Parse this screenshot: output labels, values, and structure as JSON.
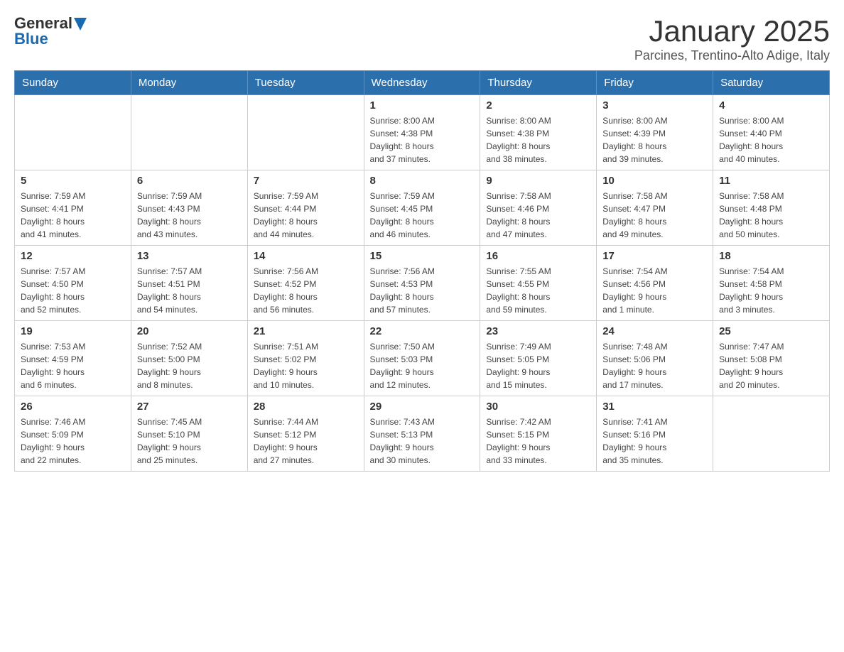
{
  "header": {
    "logo_general": "General",
    "logo_blue": "Blue",
    "month_title": "January 2025",
    "subtitle": "Parcines, Trentino-Alto Adige, Italy"
  },
  "days_of_week": [
    "Sunday",
    "Monday",
    "Tuesday",
    "Wednesday",
    "Thursday",
    "Friday",
    "Saturday"
  ],
  "weeks": [
    [
      {
        "day": "",
        "info": ""
      },
      {
        "day": "",
        "info": ""
      },
      {
        "day": "",
        "info": ""
      },
      {
        "day": "1",
        "info": "Sunrise: 8:00 AM\nSunset: 4:38 PM\nDaylight: 8 hours\nand 37 minutes."
      },
      {
        "day": "2",
        "info": "Sunrise: 8:00 AM\nSunset: 4:38 PM\nDaylight: 8 hours\nand 38 minutes."
      },
      {
        "day": "3",
        "info": "Sunrise: 8:00 AM\nSunset: 4:39 PM\nDaylight: 8 hours\nand 39 minutes."
      },
      {
        "day": "4",
        "info": "Sunrise: 8:00 AM\nSunset: 4:40 PM\nDaylight: 8 hours\nand 40 minutes."
      }
    ],
    [
      {
        "day": "5",
        "info": "Sunrise: 7:59 AM\nSunset: 4:41 PM\nDaylight: 8 hours\nand 41 minutes."
      },
      {
        "day": "6",
        "info": "Sunrise: 7:59 AM\nSunset: 4:43 PM\nDaylight: 8 hours\nand 43 minutes."
      },
      {
        "day": "7",
        "info": "Sunrise: 7:59 AM\nSunset: 4:44 PM\nDaylight: 8 hours\nand 44 minutes."
      },
      {
        "day": "8",
        "info": "Sunrise: 7:59 AM\nSunset: 4:45 PM\nDaylight: 8 hours\nand 46 minutes."
      },
      {
        "day": "9",
        "info": "Sunrise: 7:58 AM\nSunset: 4:46 PM\nDaylight: 8 hours\nand 47 minutes."
      },
      {
        "day": "10",
        "info": "Sunrise: 7:58 AM\nSunset: 4:47 PM\nDaylight: 8 hours\nand 49 minutes."
      },
      {
        "day": "11",
        "info": "Sunrise: 7:58 AM\nSunset: 4:48 PM\nDaylight: 8 hours\nand 50 minutes."
      }
    ],
    [
      {
        "day": "12",
        "info": "Sunrise: 7:57 AM\nSunset: 4:50 PM\nDaylight: 8 hours\nand 52 minutes."
      },
      {
        "day": "13",
        "info": "Sunrise: 7:57 AM\nSunset: 4:51 PM\nDaylight: 8 hours\nand 54 minutes."
      },
      {
        "day": "14",
        "info": "Sunrise: 7:56 AM\nSunset: 4:52 PM\nDaylight: 8 hours\nand 56 minutes."
      },
      {
        "day": "15",
        "info": "Sunrise: 7:56 AM\nSunset: 4:53 PM\nDaylight: 8 hours\nand 57 minutes."
      },
      {
        "day": "16",
        "info": "Sunrise: 7:55 AM\nSunset: 4:55 PM\nDaylight: 8 hours\nand 59 minutes."
      },
      {
        "day": "17",
        "info": "Sunrise: 7:54 AM\nSunset: 4:56 PM\nDaylight: 9 hours\nand 1 minute."
      },
      {
        "day": "18",
        "info": "Sunrise: 7:54 AM\nSunset: 4:58 PM\nDaylight: 9 hours\nand 3 minutes."
      }
    ],
    [
      {
        "day": "19",
        "info": "Sunrise: 7:53 AM\nSunset: 4:59 PM\nDaylight: 9 hours\nand 6 minutes."
      },
      {
        "day": "20",
        "info": "Sunrise: 7:52 AM\nSunset: 5:00 PM\nDaylight: 9 hours\nand 8 minutes."
      },
      {
        "day": "21",
        "info": "Sunrise: 7:51 AM\nSunset: 5:02 PM\nDaylight: 9 hours\nand 10 minutes."
      },
      {
        "day": "22",
        "info": "Sunrise: 7:50 AM\nSunset: 5:03 PM\nDaylight: 9 hours\nand 12 minutes."
      },
      {
        "day": "23",
        "info": "Sunrise: 7:49 AM\nSunset: 5:05 PM\nDaylight: 9 hours\nand 15 minutes."
      },
      {
        "day": "24",
        "info": "Sunrise: 7:48 AM\nSunset: 5:06 PM\nDaylight: 9 hours\nand 17 minutes."
      },
      {
        "day": "25",
        "info": "Sunrise: 7:47 AM\nSunset: 5:08 PM\nDaylight: 9 hours\nand 20 minutes."
      }
    ],
    [
      {
        "day": "26",
        "info": "Sunrise: 7:46 AM\nSunset: 5:09 PM\nDaylight: 9 hours\nand 22 minutes."
      },
      {
        "day": "27",
        "info": "Sunrise: 7:45 AM\nSunset: 5:10 PM\nDaylight: 9 hours\nand 25 minutes."
      },
      {
        "day": "28",
        "info": "Sunrise: 7:44 AM\nSunset: 5:12 PM\nDaylight: 9 hours\nand 27 minutes."
      },
      {
        "day": "29",
        "info": "Sunrise: 7:43 AM\nSunset: 5:13 PM\nDaylight: 9 hours\nand 30 minutes."
      },
      {
        "day": "30",
        "info": "Sunrise: 7:42 AM\nSunset: 5:15 PM\nDaylight: 9 hours\nand 33 minutes."
      },
      {
        "day": "31",
        "info": "Sunrise: 7:41 AM\nSunset: 5:16 PM\nDaylight: 9 hours\nand 35 minutes."
      },
      {
        "day": "",
        "info": ""
      }
    ]
  ]
}
